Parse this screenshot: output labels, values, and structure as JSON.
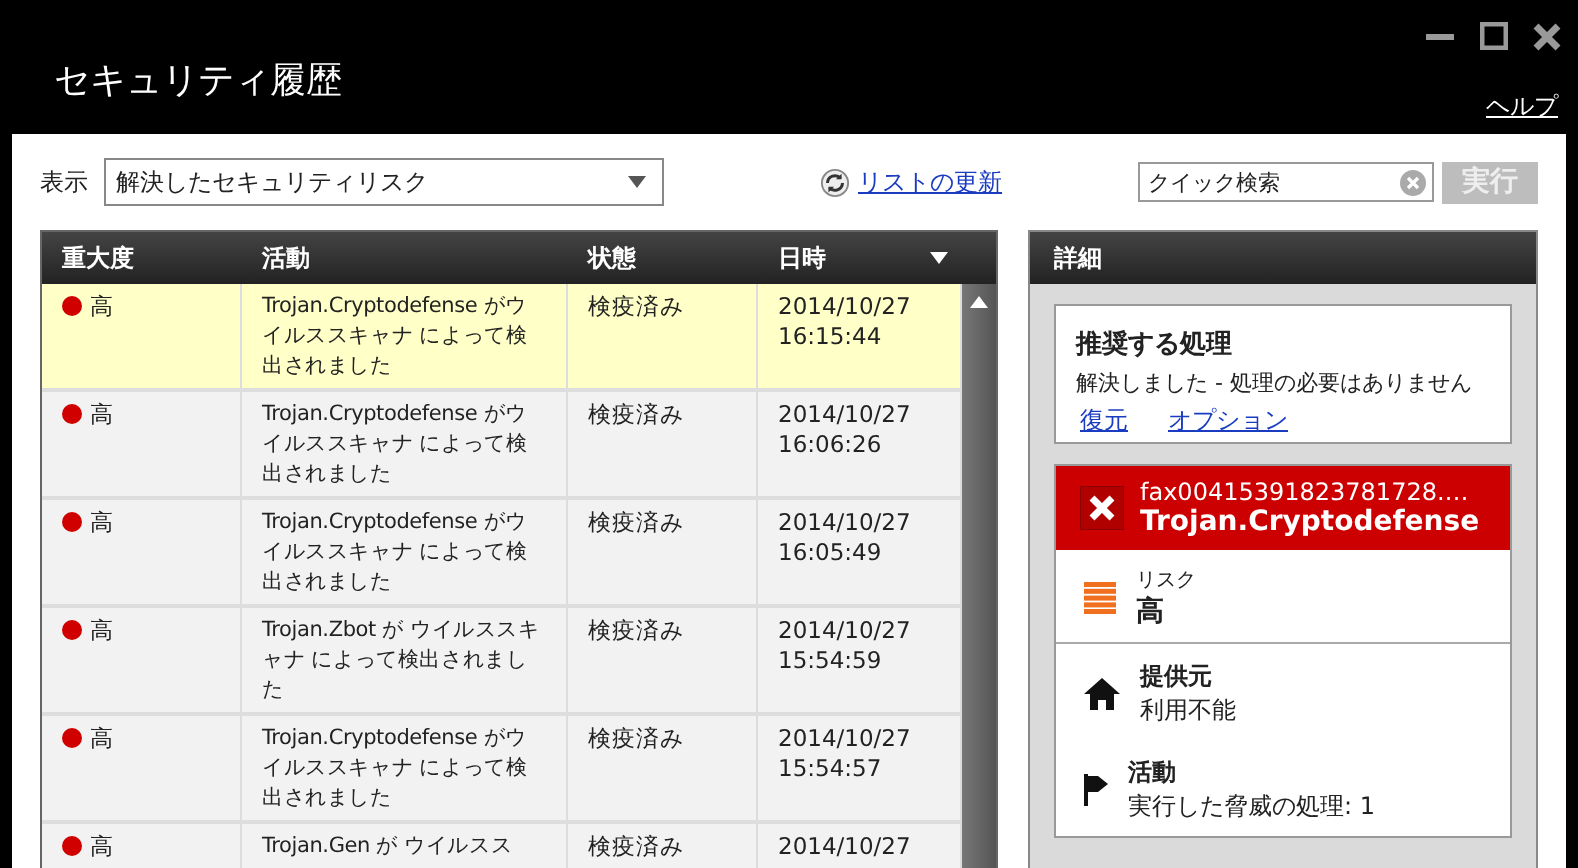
{
  "window": {
    "title": "セキュリティ履歴",
    "help_link": "ヘルプ"
  },
  "toolbar": {
    "view_label": "表示",
    "view_value": "解決したセキュリティリスク",
    "refresh_link": "リストの更新",
    "search": {
      "value": "クイック検索"
    },
    "run_button": {
      "label": "実行",
      "disabled": true
    }
  },
  "table": {
    "columns": [
      "重大度",
      "活動",
      "状態",
      "日時"
    ],
    "rows": [
      {
        "severity": "高",
        "activity": "Trojan.Cryptodefense がウイルススキャナ によって検出されました",
        "status": "検疫済み",
        "datetime": "2014/10/27 16:15:44",
        "selected": true
      },
      {
        "severity": "高",
        "activity": "Trojan.Cryptodefense がウイルススキャナ によって検出されました",
        "status": "検疫済み",
        "datetime": "2014/10/27 16:06:26",
        "selected": false
      },
      {
        "severity": "高",
        "activity": "Trojan.Cryptodefense がウイルススキャナ によって検出されました",
        "status": "検疫済み",
        "datetime": "2014/10/27 16:05:49",
        "selected": false
      },
      {
        "severity": "高",
        "activity": "Trojan.Zbot が ウイルススキャナ によって検出されました",
        "status": "検疫済み",
        "datetime": "2014/10/27 15:54:59",
        "selected": false
      },
      {
        "severity": "高",
        "activity": "Trojan.Cryptodefense がウイルススキャナ によって検出されました",
        "status": "検疫済み",
        "datetime": "2014/10/27 15:54:57",
        "selected": false
      },
      {
        "severity": "高",
        "activity": "Trojan.Gen が ウイルスス",
        "status": "検疫済み",
        "datetime": "2014/10/27",
        "selected": false
      }
    ]
  },
  "details": {
    "title": "詳細",
    "recommendation": {
      "heading": "推奨する処理",
      "text": "解決しました - 処理の必要はありません",
      "links": [
        "復元",
        "オプション"
      ]
    },
    "threat": {
      "file": "fax00415391823781728.…",
      "name": "Trojan.Cryptodefense"
    },
    "sections": [
      {
        "kind": "risk",
        "label": "リスク",
        "value": "高"
      },
      {
        "kind": "source",
        "label": "提供元",
        "value": "利用不能"
      },
      {
        "kind": "activity",
        "label": "活動",
        "value": "実行した脅威の処理: 1"
      }
    ]
  }
}
